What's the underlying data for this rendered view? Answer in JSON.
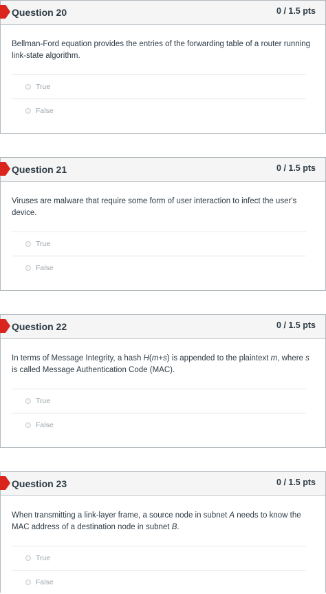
{
  "questions": [
    {
      "title": "Question 20",
      "score": "0 / 1.5 pts",
      "text": "Bellman-Ford equation provides the entries of the forwarding table of a router running link-state algorithm.",
      "answers": [
        "True",
        "False"
      ]
    },
    {
      "title": "Question 21",
      "score": "0 / 1.5 pts",
      "text": "Viruses are malware that require some form of user interaction to infect the user's device.",
      "answers": [
        "True",
        "False"
      ]
    },
    {
      "title": "Question 22",
      "score": "0 / 1.5 pts",
      "text_parts": {
        "p1": "In terms of Message Integrity, a hash ",
        "p2": "H",
        "p3": "(",
        "p4": "m+s",
        "p5": ") is appended to the plaintext ",
        "p6": "m",
        "p7": ", where ",
        "p8": "s",
        "p9": " is called Message Authentication Code (MAC)."
      },
      "answers": [
        "True",
        "False"
      ]
    },
    {
      "title": "Question 23",
      "score": "0 / 1.5 pts",
      "text_parts": {
        "p1": "When transmitting a link-layer frame, a source node in subnet ",
        "p2": "A",
        "p3": " needs to know the MAC address of a destination node in subnet ",
        "p4": "B",
        "p5": "."
      },
      "answers": [
        "True",
        "False"
      ]
    }
  ],
  "colors": {
    "flag": "#d9251d",
    "header_bg": "#f5f5f5",
    "text": "#2d3b45",
    "muted": "#9aa4ab"
  }
}
